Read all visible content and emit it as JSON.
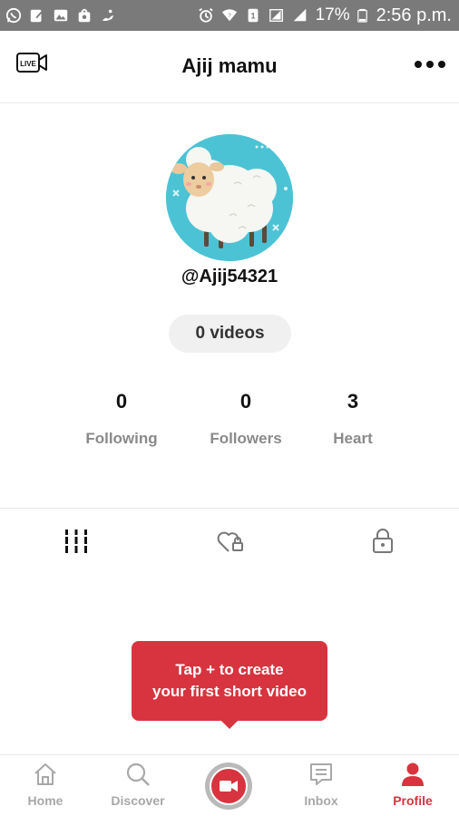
{
  "status_bar": {
    "battery_percent": "17%",
    "time": "2:56 p.m.",
    "background": "#7a7a7a",
    "left_icons": [
      "whatsapp-icon",
      "edit-icon",
      "image-icon",
      "store-icon",
      "hand-icon"
    ],
    "right_icons": [
      "alarm-icon",
      "wifi-icon",
      "data-icon",
      "signal-icon",
      "signal-icon",
      "battery-icon"
    ]
  },
  "header": {
    "title": "Ajij mamu",
    "live_badge": "LIVE",
    "left_icon": "live-camera-icon",
    "right_icon": "more-icon"
  },
  "profile": {
    "username": "@Ajij54321",
    "videos_label": "0 videos",
    "avatar": "sheep-avatar",
    "stats": [
      {
        "value": "0",
        "label": "Following"
      },
      {
        "value": "0",
        "label": "Followers"
      },
      {
        "value": "3",
        "label": "Heart"
      }
    ]
  },
  "content_tabs": [
    {
      "icon": "videos-grid-icon",
      "active": true
    },
    {
      "icon": "liked-heart-lock-icon",
      "active": false
    },
    {
      "icon": "private-lock-icon",
      "active": false
    }
  ],
  "tooltip": {
    "line1": "Tap + to create",
    "line2": "your first short video"
  },
  "bottom_nav": [
    {
      "label": "Home",
      "icon": "home-icon",
      "active": false
    },
    {
      "label": "Discover",
      "icon": "search-icon",
      "active": false
    },
    {
      "label": "",
      "icon": "record-camera-icon",
      "active": false
    },
    {
      "label": "Inbox",
      "icon": "inbox-icon",
      "active": false
    },
    {
      "label": "Profile",
      "icon": "person-icon",
      "active": true
    }
  ],
  "colors": {
    "accent": "#d7343f",
    "avatar_bg": "#4cc3d4",
    "inactive": "#a8a8a8",
    "pill_bg": "#f0f0f0"
  }
}
